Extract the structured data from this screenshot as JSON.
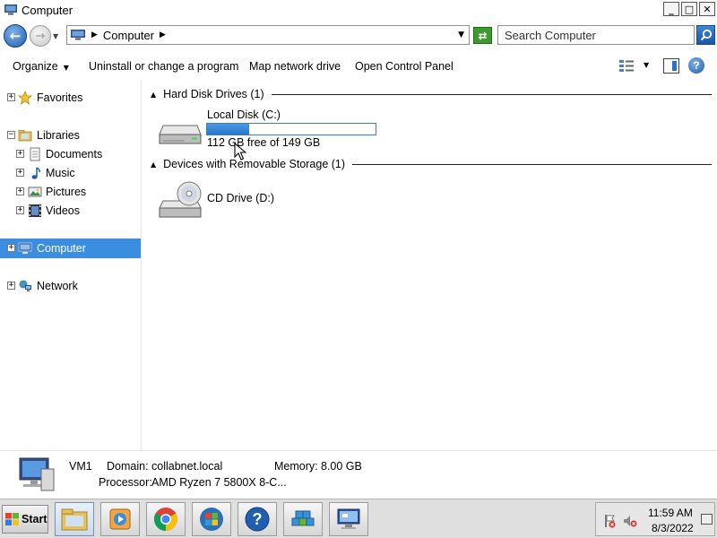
{
  "window": {
    "title": "Computer",
    "buttons": {
      "minimize": "_",
      "maximize": "□",
      "close": "✕"
    }
  },
  "address_bar": {
    "breadcrumb": "Computer",
    "search_placeholder": "Search Computer"
  },
  "command_bar": {
    "organize": "Organize",
    "uninstall": "Uninstall or change a program",
    "map_drive": "Map network drive",
    "control_panel": "Open Control Panel"
  },
  "nav": {
    "favorites": "Favorites",
    "libraries": "Libraries",
    "documents": "Documents",
    "music": "Music",
    "pictures": "Pictures",
    "videos": "Videos",
    "computer": "Computer",
    "network": "Network"
  },
  "content": {
    "hard_disk_group": "Hard Disk Drives (1)",
    "local_disk": {
      "name": "Local Disk (C:)",
      "free_text": "112 GB free of 149 GB",
      "used_fraction": 0.248
    },
    "removable_group": "Devices with Removable Storage (1)",
    "cd_drive": {
      "name": "CD Drive (D:)"
    }
  },
  "details": {
    "name": "VM1",
    "domain_label": "Domain:",
    "domain_value": "collabnet.local",
    "memory_label": "Memory:",
    "memory_value": "8.00 GB",
    "processor_label": "Processor:",
    "processor_value": "AMD Ryzen 7 5800X 8-C..."
  },
  "taskbar": {
    "start": "Start",
    "time": "11:59 AM",
    "date": "8/3/2022"
  },
  "colors": {
    "selection": "#3b8de0",
    "capacity_fill": "#2677cc",
    "taskbar": "#dfdfdf"
  }
}
